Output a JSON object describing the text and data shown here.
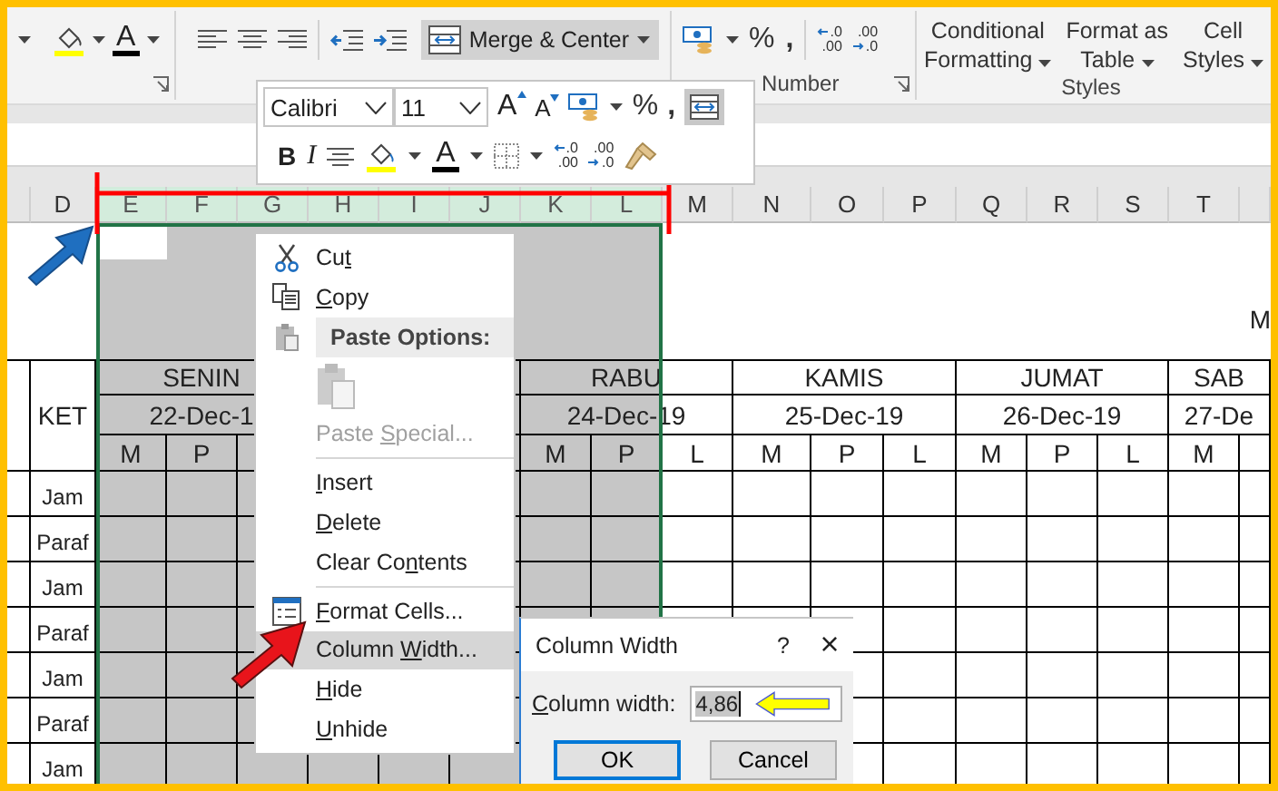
{
  "ribbon": {
    "font_color_letter": "A",
    "merge_button": {
      "label": "Merge & Center",
      "active": true
    },
    "number_group": {
      "label": "Number",
      "percent": "%",
      "comma": ",",
      "decimal_left": [
        ".0",
        ".00"
      ],
      "decimal_right": [
        ".00",
        ".0"
      ]
    },
    "styles_group": {
      "label": "Styles",
      "buttons": [
        [
          "Conditional",
          "Formatting"
        ],
        [
          "Format as",
          "Table"
        ],
        [
          "Cell",
          "Styles"
        ]
      ]
    }
  },
  "mini_toolbar": {
    "font": "Calibri",
    "size": "11",
    "grow_font": "A",
    "shrink_font": "A",
    "percent": "%",
    "comma": ",",
    "merge_active": true,
    "bold": "B",
    "italic": "I",
    "font_color": "A",
    "decimal_left": [
      ".0",
      ".00"
    ],
    "decimal_right": [
      ".00",
      ".0"
    ]
  },
  "sheet": {
    "columns": [
      {
        "label": "D",
        "selected": false
      },
      {
        "label": "E",
        "selected": true
      },
      {
        "label": "F",
        "selected": true
      },
      {
        "label": "G",
        "selected": true
      },
      {
        "label": "H",
        "selected": true
      },
      {
        "label": "I",
        "selected": true
      },
      {
        "label": "J",
        "selected": true
      },
      {
        "label": "K",
        "selected": true
      },
      {
        "label": "L",
        "selected": true
      },
      {
        "label": "M",
        "selected": false
      },
      {
        "label": "N",
        "selected": false
      },
      {
        "label": "O",
        "selected": false
      },
      {
        "label": "P",
        "selected": false
      },
      {
        "label": "Q",
        "selected": false
      },
      {
        "label": "R",
        "selected": false
      },
      {
        "label": "S",
        "selected": false
      },
      {
        "label": "T",
        "selected": false
      }
    ],
    "title_fragment": "M",
    "key_header": "KET",
    "days": [
      {
        "name": "SENIN",
        "date": "22-Dec-1"
      },
      {
        "name": "RABU",
        "date": "24-Dec-19"
      },
      {
        "name": "KAMIS",
        "date": "25-Dec-19"
      },
      {
        "name": "JUMAT",
        "date": "26-Dec-19"
      },
      {
        "name": "SAB",
        "date": "27-De"
      }
    ],
    "shifts": [
      "M",
      "P",
      "M",
      "P",
      "L",
      "M",
      "P",
      "L",
      "M",
      "P",
      "L",
      "M"
    ],
    "row_labels": [
      "Jam",
      "Paraf",
      "Jam",
      "Paraf",
      "Jam",
      "Paraf",
      "Jam"
    ]
  },
  "context_menu": {
    "items": [
      {
        "kind": "command",
        "label": {
          "pre": "Cu",
          "key": "t"
        },
        "disabled": false,
        "selected": false
      },
      {
        "kind": "command",
        "label": {
          "key": "C",
          "post": "opy"
        },
        "disabled": false,
        "selected": false
      },
      {
        "kind": "header",
        "text": "Paste Options:"
      },
      {
        "kind": "paste-icons",
        "disabled": true
      },
      {
        "kind": "command",
        "label": {
          "pre": "Paste ",
          "key": "S",
          "post": "pecial..."
        },
        "disabled": true,
        "selected": false
      },
      {
        "kind": "separator"
      },
      {
        "kind": "command",
        "label": {
          "key": "I",
          "post": "nsert"
        },
        "disabled": false,
        "selected": false
      },
      {
        "kind": "command",
        "label": {
          "key": "D",
          "post": "elete"
        },
        "disabled": false,
        "selected": false
      },
      {
        "kind": "command",
        "label": {
          "pre": "Clear Co",
          "key": "n",
          "post": "tents"
        },
        "disabled": false,
        "selected": false
      },
      {
        "kind": "separator"
      },
      {
        "kind": "command",
        "label": {
          "key": "F",
          "post": "ormat Cells..."
        },
        "disabled": false,
        "selected": false
      },
      {
        "kind": "command",
        "label": {
          "pre": "Column ",
          "key": "W",
          "post": "idth..."
        },
        "disabled": false,
        "selected": true
      },
      {
        "kind": "command",
        "label": {
          "key": "H",
          "post": "ide"
        },
        "disabled": false,
        "selected": false
      },
      {
        "kind": "command",
        "label": {
          "key": "U",
          "post": "nhide"
        },
        "disabled": false,
        "selected": false
      }
    ]
  },
  "dialog": {
    "title": "Column Width",
    "help": "?",
    "close": "×",
    "field_label": {
      "key": "C",
      "post": "olumn width:"
    },
    "value": "4,86",
    "value_selected": true,
    "buttons": [
      {
        "label": "OK",
        "default": true
      },
      {
        "label": "Cancel",
        "default": false
      }
    ]
  }
}
